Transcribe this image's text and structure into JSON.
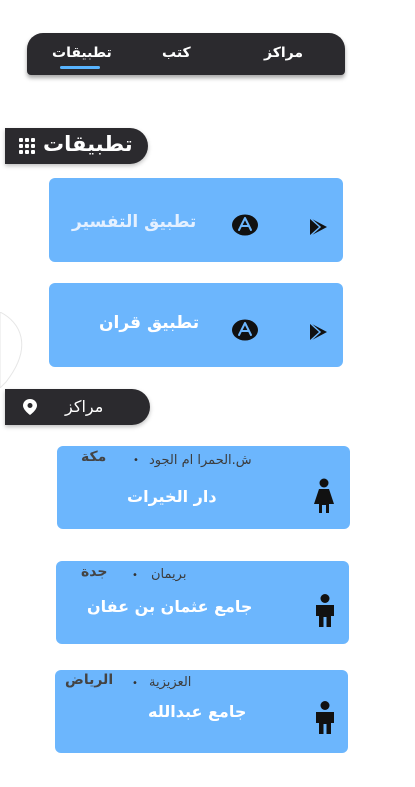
{
  "tabs": [
    {
      "label": "مراكز"
    },
    {
      "label": "كتب"
    },
    {
      "label": "تطبيقات",
      "active": true
    }
  ],
  "apps_section": {
    "title": "تطبيقات",
    "icon": "grid-icon",
    "items": [
      {
        "name": "تطبيق التفسير",
        "icons": [
          "appstore-icon",
          "google-play-icon"
        ]
      },
      {
        "name": "تطبيق قران",
        "icons": [
          "appstore-icon",
          "google-play-icon"
        ]
      }
    ]
  },
  "centers_section": {
    "title": "مراكز",
    "icon": "location-pin-icon",
    "items": [
      {
        "city": "مكة",
        "address": "ش.الحمرا ام الجود",
        "name": "دار الخيرات",
        "icon": "female-person-icon"
      },
      {
        "city": "جدة",
        "address": "بريمان",
        "name": "جامع عثمان بن عفان",
        "icon": "male-person-icon"
      },
      {
        "city": "الرياض",
        "address": "العزيزية",
        "name": "جامع عبدالله",
        "icon": "male-person-icon"
      }
    ]
  },
  "separator": "•",
  "colors": {
    "dark": "#2b2a2e",
    "card": "#6cb6fd",
    "accent": "#58b4ff",
    "text_light": "#ffffff"
  }
}
